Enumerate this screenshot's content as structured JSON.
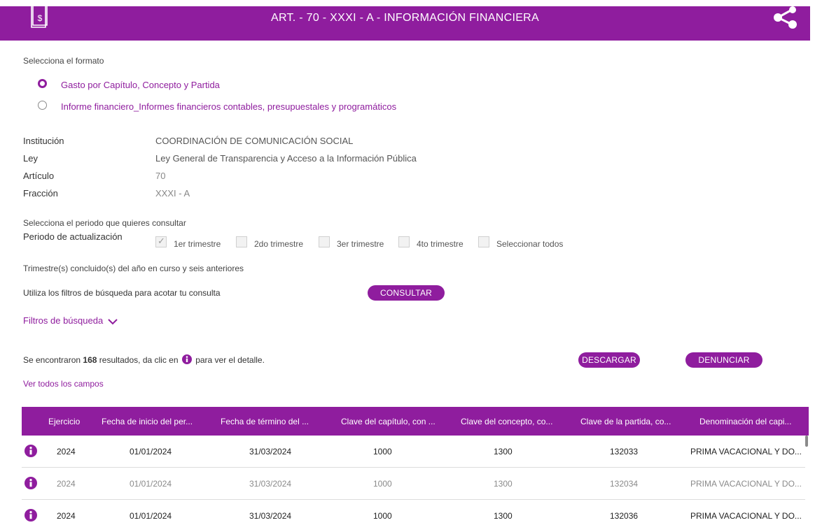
{
  "header": {
    "title": "ART. - 70 - XXXI - A - INFORMACIÓN FINANCIERA"
  },
  "format": {
    "label": "Selecciona el formato",
    "options": [
      {
        "label": "Gasto por Capítulo, Concepto y Partida",
        "selected": true
      },
      {
        "label": "Informe financiero_Informes financieros contables, presupuestales y programáticos",
        "selected": false
      }
    ]
  },
  "info": [
    {
      "label": "Institución",
      "value": "COORDINACIÓN DE COMUNICACIÓN SOCIAL"
    },
    {
      "label": "Ley",
      "value": "Ley General de Transparencia y Acceso a la Información Pública"
    },
    {
      "label": "Artículo",
      "value": "70"
    },
    {
      "label": "Fracción",
      "value": "XXXI - A"
    }
  ],
  "period": {
    "prompt": "Selecciona el periodo que quieres consultar",
    "label": "Periodo de actualización",
    "options": [
      {
        "label": "1er trimestre",
        "checked": true
      },
      {
        "label": "2do trimestre",
        "checked": false
      },
      {
        "label": "3er trimestre",
        "checked": false
      },
      {
        "label": "4to trimestre",
        "checked": false
      },
      {
        "label": "Seleccionar todos",
        "checked": false
      }
    ],
    "note": "Trimestre(s) concluido(s) del año en curso y seis anteriores"
  },
  "filters": {
    "hint": "Utiliza los filtros de búsqueda para acotar tu consulta",
    "consult_button": "CONSULTAR",
    "toggle_label": "Filtros de búsqueda"
  },
  "results": {
    "prefix": "Se encontraron",
    "count": "168",
    "middle": "resultados, da clic en",
    "suffix": "para ver el detalle.",
    "download_button": "DESCARGAR",
    "report_button": "DENUNCIAR",
    "view_all_link": "Ver todos los campos"
  },
  "table": {
    "columns": [
      "Ejercicio",
      "Fecha de inicio del per...",
      "Fecha de término del ...",
      "Clave del capítulo, con ...",
      "Clave del concepto, co...",
      "Clave de la partida, co...",
      "Denominación del capi..."
    ],
    "rows": [
      [
        "2024",
        "01/01/2024",
        "31/03/2024",
        "1000",
        "1300",
        "132033",
        "PRIMA VACACIONAL Y DO..."
      ],
      [
        "2024",
        "01/01/2024",
        "31/03/2024",
        "1000",
        "1300",
        "132034",
        "PRIMA VACACIONAL Y DO..."
      ],
      [
        "2024",
        "01/01/2024",
        "31/03/2024",
        "1000",
        "1300",
        "132036",
        "PRIMA VACACIONAL Y DO..."
      ]
    ]
  },
  "colors": {
    "brand": "#8f1d9e",
    "text": "#333333",
    "muted_row": "#8a8a8a"
  }
}
